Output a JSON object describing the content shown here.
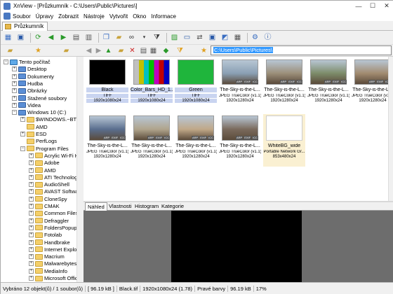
{
  "window": {
    "title": "XnView - [Průzkumník - C:\\Users\\Public\\Pictures\\]",
    "min_glyph": "—",
    "max_glyph": "☐",
    "close_glyph": "✕"
  },
  "menu": [
    "Soubor",
    "Úpravy",
    "Zobrazit",
    "Nástroje",
    "Vytvořit",
    "Okno",
    "Informace"
  ],
  "tab": {
    "label": "Průzkumník"
  },
  "address": {
    "value": "C:\\Users\\Public\\Pictures\\"
  },
  "tree": [
    {
      "label": "Tento počítač",
      "icon": "computer-icon",
      "expand": "−"
    },
    {
      "label": "Desktop",
      "icon": "folder-icon",
      "expand": "+"
    },
    {
      "label": "Dokumenty",
      "icon": "folder-icon",
      "expand": "+"
    },
    {
      "label": "Hudba",
      "icon": "folder-icon",
      "expand": "+"
    },
    {
      "label": "Obrázky",
      "icon": "folder-icon",
      "expand": "+"
    },
    {
      "label": "Stažené soubory",
      "icon": "folder-icon",
      "expand": "+"
    },
    {
      "label": "Videa",
      "icon": "folder-icon",
      "expand": "+"
    },
    {
      "label": "Windows 10 (C:)",
      "icon": "drive-icon",
      "expand": "−"
    },
    {
      "label": "$WINDOWS.~BT",
      "icon": "folder-icon",
      "expand": "+"
    },
    {
      "label": "AMD",
      "icon": "folder-icon",
      "expand": ""
    },
    {
      "label": "ESD",
      "icon": "folder-icon",
      "expand": "+"
    },
    {
      "label": "PerfLogs",
      "icon": "folder-icon",
      "expand": ""
    },
    {
      "label": "Program Files",
      "icon": "folder-icon",
      "expand": "−"
    },
    {
      "label": "Acrylic Wi-Fi H",
      "icon": "folder-icon",
      "expand": "+"
    },
    {
      "label": "Adobe",
      "icon": "folder-icon",
      "expand": "+"
    },
    {
      "label": "AMD",
      "icon": "folder-icon",
      "expand": "+"
    },
    {
      "label": "ATI Technolog",
      "icon": "folder-icon",
      "expand": "+"
    },
    {
      "label": "AudioShell",
      "icon": "folder-icon",
      "expand": "+"
    },
    {
      "label": "AVAST Softwa",
      "icon": "folder-icon",
      "expand": "+"
    },
    {
      "label": "CloneSpy",
      "icon": "folder-icon",
      "expand": "+"
    },
    {
      "label": "CMAK",
      "icon": "folder-icon",
      "expand": "+"
    },
    {
      "label": "Common Files",
      "icon": "folder-icon",
      "expand": "+"
    },
    {
      "label": "Defraggler",
      "icon": "folder-icon",
      "expand": "+"
    },
    {
      "label": "FoldersPopup",
      "icon": "folder-icon",
      "expand": "+"
    },
    {
      "label": "Fotolab",
      "icon": "folder-icon",
      "expand": "+"
    },
    {
      "label": "Handbrake",
      "icon": "folder-icon",
      "expand": "+"
    },
    {
      "label": "Internet Explor",
      "icon": "folder-icon",
      "expand": "+"
    },
    {
      "label": "Macrium",
      "icon": "folder-icon",
      "expand": "+"
    },
    {
      "label": "Malwarebytes",
      "icon": "folder-icon",
      "expand": "+"
    },
    {
      "label": "MediaInfo",
      "icon": "folder-icon",
      "expand": "+"
    },
    {
      "label": "Microsoft Offic",
      "icon": "folder-icon",
      "expand": "+"
    }
  ],
  "thumbnails": [
    {
      "name": "Black",
      "format": "TIFF",
      "dims": "1920x1080x24",
      "color": "#000000",
      "selected": true
    },
    {
      "name": "Color_Bars_HD_1...",
      "format": "TIFF",
      "dims": "1920x1080x24",
      "color": "colorbars",
      "selected": true
    },
    {
      "name": "Green",
      "format": "TIFF",
      "dims": "1920x1080x24",
      "color": "#1fb53c",
      "selected": true
    },
    {
      "name": "The-Sky-is-the-L...",
      "format": "JPEG TrueColor (v1.1)",
      "dims": "1920x1280x24",
      "color": "#8aa0b4",
      "selected": false
    },
    {
      "name": "The-Sky-is-the-L...",
      "format": "JPEG TrueColor (v1.1)",
      "dims": "1920x1280x24",
      "color": "#9c8f7a",
      "selected": false
    },
    {
      "name": "The-Sky-is-the-L...",
      "format": "JPEG TrueColor (v1.1)",
      "dims": "1920x1280x24",
      "color": "#7d8c6a",
      "selected": false
    },
    {
      "name": "The-Sky-is-the-L...",
      "format": "JPEG TrueColor (v1.1)",
      "dims": "1920x1280x24",
      "color": "#a28b70",
      "selected": false
    },
    {
      "name": "The-Sky-is-the-L...",
      "format": "JPEG TrueColor (v1.1)",
      "dims": "1920x1280x24",
      "color": "#5a6e8e",
      "selected": false
    },
    {
      "name": "The-Sky-is-the-L...",
      "format": "JPEG TrueColor (v1.1)",
      "dims": "1920x1280x24",
      "color": "#b0a48c",
      "selected": false
    },
    {
      "name": "The-Sky-is-the-L...",
      "format": "JPEG TrueColor (v1.1)",
      "dims": "1920x1280x24",
      "color": "#c0a888",
      "selected": false
    },
    {
      "name": "The-Sky-is-the-L...",
      "format": "JPEG TrueColor (v1.1)",
      "dims": "1920x1280x24",
      "color": "#7a6a5c",
      "selected": false
    },
    {
      "name": "WhiteBG_wide",
      "format": "Portable Network Gr...",
      "dims": "853x480x24",
      "color": "#ffffff",
      "selected": false
    }
  ],
  "thumb_badges": [
    "ARP",
    "EXIF",
    "ICC"
  ],
  "preview_tabs": [
    "Náhled",
    "Vlastnosti",
    "Histogram",
    "Kategorie"
  ],
  "status": {
    "summary": "Vybráno 12 objekt(ů) / 1 soubor(ů)",
    "size": "[ 96.19 kB ]",
    "file": "Black.tif",
    "dims": "1920x1080x24 (1.78)",
    "color_mode": "Pravé barvy",
    "file_size": "96.19 kB",
    "zoom": "17%"
  }
}
